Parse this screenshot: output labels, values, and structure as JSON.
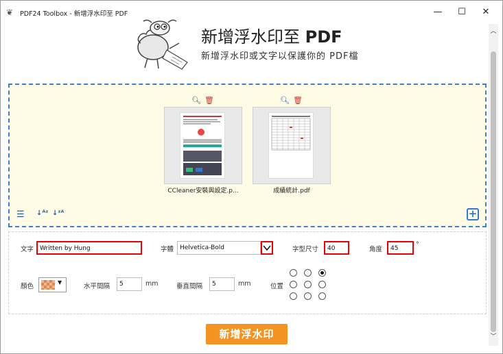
{
  "window": {
    "title": "PDF24 Toolbox - 新增浮水印至 PDF",
    "minimize": "—",
    "maximize": "☐",
    "close": "✕"
  },
  "header": {
    "title_main": "新增浮水印至 ",
    "title_bold": "PDF",
    "subtitle": "新增浮水印或文字以保護你的 PDF檔"
  },
  "files": [
    {
      "name": "CCleaner安裝與設定.p..."
    },
    {
      "name": "成績統計.pdf"
    }
  ],
  "settings": {
    "text_label": "文字",
    "text_value": "Written by Hung",
    "font_label": "字體",
    "font_value": "Helvetica-Bold",
    "font_size_label": "字型尺寸",
    "font_size_value": "40",
    "angle_label": "角度",
    "angle_value": "45",
    "angle_unit": "°",
    "color_label": "顏色",
    "h_spacing_label": "水平間隔",
    "h_spacing_value": "5",
    "h_spacing_unit": "mm",
    "v_spacing_label": "垂直間隔",
    "v_spacing_value": "5",
    "v_spacing_unit": "mm",
    "position_label": "位置",
    "position_selected": "top-right"
  },
  "actions": {
    "submit_label": "新增浮水印"
  },
  "colors": {
    "accent": "#f39422",
    "dropzone_bg": "#fffbe4",
    "dropzone_border": "#3a7fd0",
    "highlight": "#e00000"
  }
}
